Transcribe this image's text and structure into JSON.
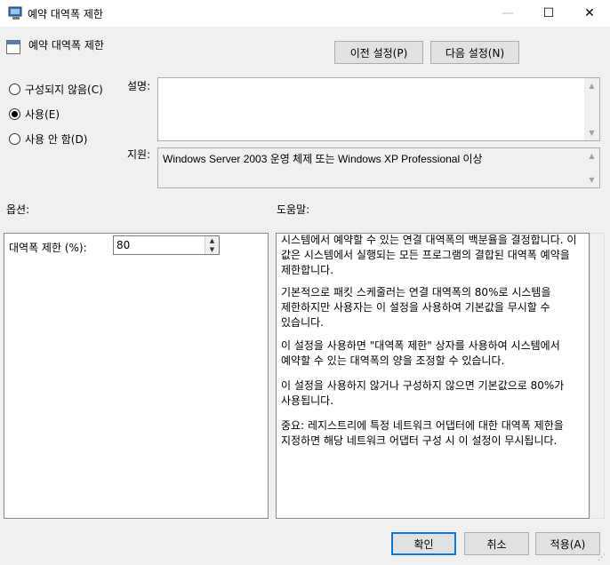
{
  "window": {
    "title": "예약 대역폭 제한",
    "minimize_icon": "—",
    "maximize_icon": "☐",
    "close_icon": "✕"
  },
  "header": {
    "policy_name": "예약 대역폭 제한",
    "prev_button": "이전 설정(P)",
    "next_button": "다음 설정(N)"
  },
  "state": {
    "options": [
      {
        "label": "구성되지 않음(C)",
        "checked": false
      },
      {
        "label": "사용(E)",
        "checked": true
      },
      {
        "label": "사용 안 함(D)",
        "checked": false
      }
    ]
  },
  "description": {
    "label": "설명:",
    "value": ""
  },
  "supported": {
    "label": "지원:",
    "value": "Windows Server 2003 운영 체제 또는 Windows XP Professional 이상"
  },
  "options_section": {
    "label": "옵션:",
    "bandwidth_label": "대역폭 제한 (%):",
    "bandwidth_value": "80"
  },
  "help_section": {
    "label": "도움말:",
    "paragraphs": [
      "시스템에서 예약할 수 있는 연결 대역폭의 백분율을 결정합니다. 이 값은 시스템에서 실행되는 모든 프로그램의 결합된 대역폭 예약을 제한합니다.",
      "기본적으로 패킷 스케줄러는 연결 대역폭의 80%로 시스템을 제한하지만 사용자는 이 설정을 사용하여 기본값을 무시할 수 있습니다.",
      "이 설정을 사용하면 \"대역폭 제한\" 상자를 사용하여 시스템에서 예약할 수 있는 대역폭의 양을 조정할 수 있습니다.",
      "이 설정을 사용하지 않거나 구성하지 않으면 기본값으로 80%가 사용됩니다.",
      "중요: 레지스트리에 특정 네트워크 어댑터에 대한 대역폭 제한을 지정하면 해당 네트워크 어댑터 구성 시 이 설정이 무시됩니다."
    ]
  },
  "footer": {
    "ok": "확인",
    "cancel": "취소",
    "apply": "적용(A)"
  }
}
